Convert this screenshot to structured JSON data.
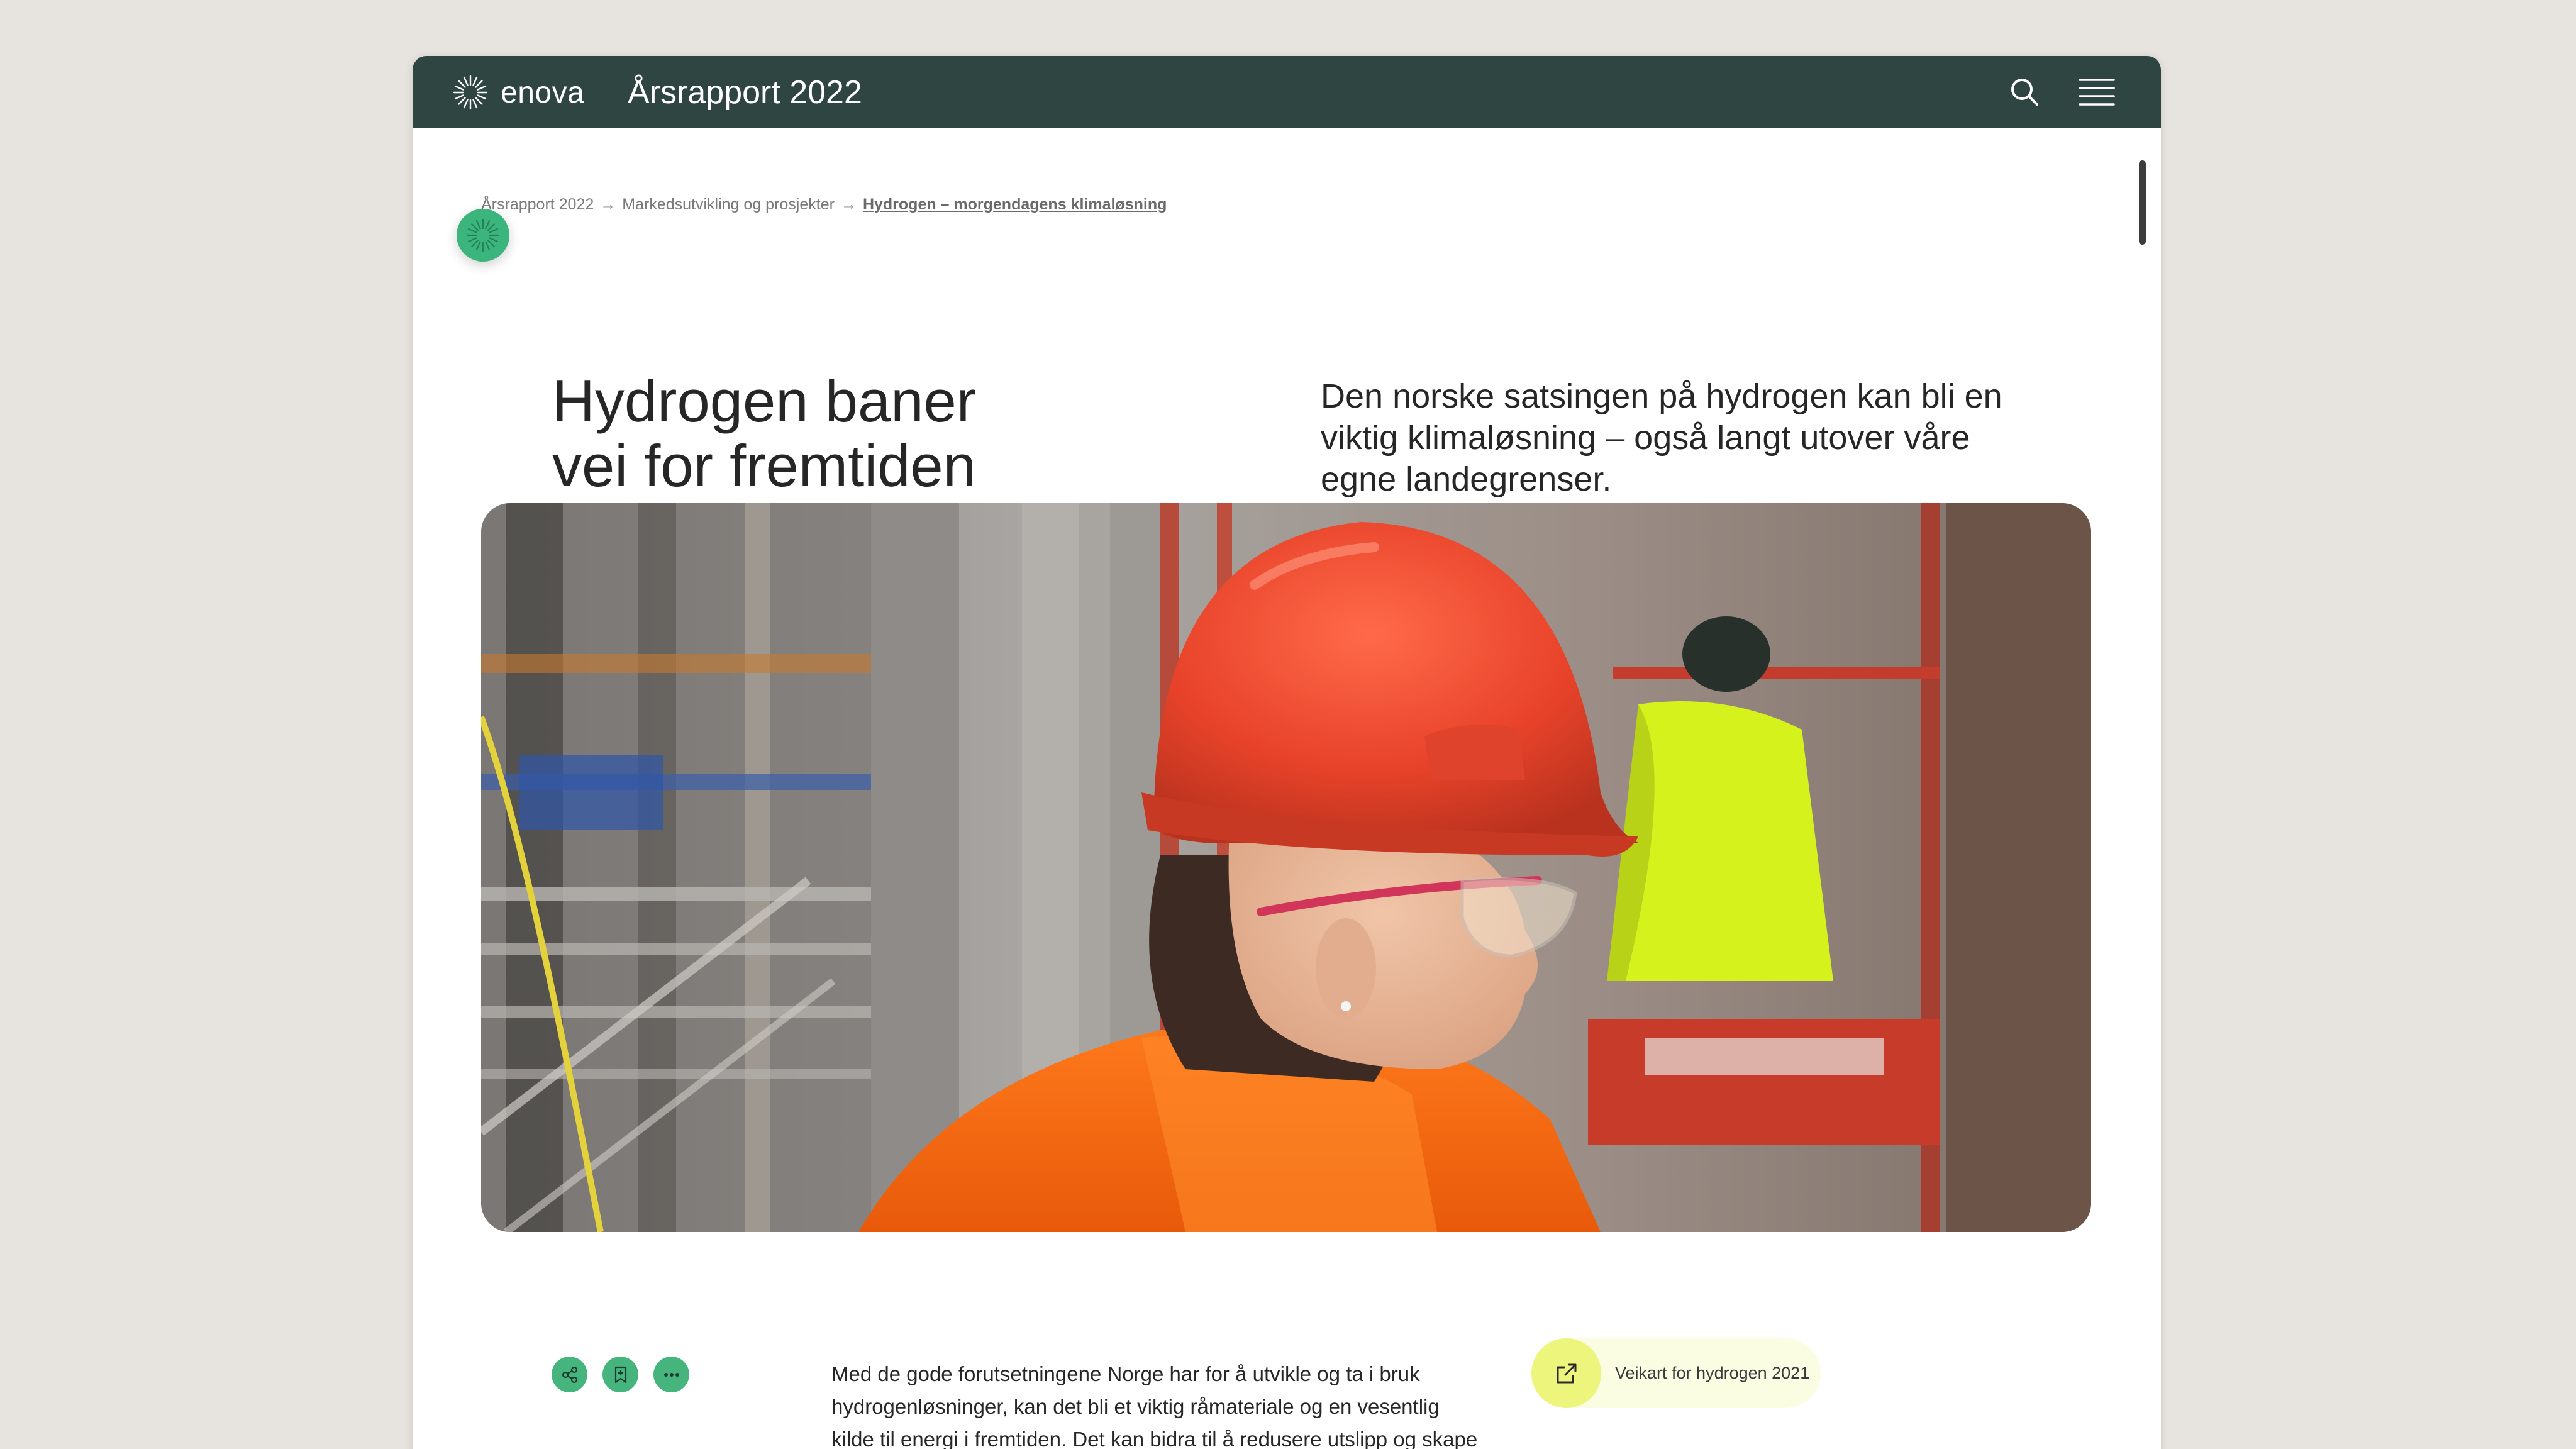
{
  "header": {
    "logo_text": "enova",
    "title": "Årsrapport 2022",
    "search_icon": "search-icon",
    "menu_icon": "hamburger-menu-icon"
  },
  "breadcrumb": {
    "items": [
      "Årsrapport 2022",
      "Markedsutvikling og prosjekter"
    ],
    "current": "Hydrogen – morgendagens klimaløsning",
    "separator": "→"
  },
  "article": {
    "headline_line1": "Hydrogen baner",
    "headline_line2": "vei for fremtiden",
    "lead": "Den norske satsingen på hydrogen kan bli en viktig klimaløsning – også langt utover våre egne landegrenser.",
    "body": "Med de gode forutsetningene Norge har for å utvikle og ta i bruk hydrogenløsninger, kan det bli et viktig råmateriale og en vesentlig kilde til energi i fremtiden. Det kan bidra til å redusere utslipp og skape verdier for norsk næringsliv. Spesielt der elektrifisering er vanskelig, eller ikke et alternativ. Dette i følge"
  },
  "actions": {
    "share_icon": "share-icon",
    "bookmark_icon": "bookmark-icon",
    "more_icon": "more-icon"
  },
  "related": {
    "label": "Veikart for hydrogen 2021",
    "icon": "external-link-icon"
  },
  "colors": {
    "topbar": "#2e4542",
    "accent_green": "#45b57d",
    "link_yellow": "#edf57d",
    "page_bg": "#e7e4df"
  }
}
